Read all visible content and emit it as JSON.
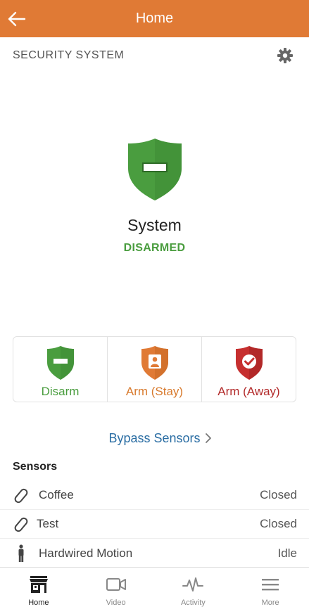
{
  "header": {
    "title": "Home"
  },
  "section": {
    "title": "SECURITY SYSTEM"
  },
  "system": {
    "name": "System",
    "state": "DISARMED"
  },
  "arm_buttons": [
    {
      "label": "Disarm"
    },
    {
      "label": "Arm (Stay)"
    },
    {
      "label": "Arm (Away)"
    }
  ],
  "bypass": {
    "label": "Bypass Sensors"
  },
  "sensors": {
    "title": "Sensors",
    "items": [
      {
        "name": "Coffee",
        "status": "Closed",
        "icon": "contact-sensor-icon"
      },
      {
        "name": "Test",
        "status": "Closed",
        "icon": "contact-sensor-icon"
      },
      {
        "name": "Hardwired Motion",
        "status": "Idle",
        "icon": "motion-person-icon"
      }
    ]
  },
  "tabs": [
    {
      "label": "Home",
      "icon": "home-store-icon",
      "active": true
    },
    {
      "label": "Video",
      "icon": "video-camera-icon",
      "active": false
    },
    {
      "label": "Activity",
      "icon": "activity-pulse-icon",
      "active": false
    },
    {
      "label": "More",
      "icon": "menu-icon",
      "active": false
    }
  ],
  "colors": {
    "header": "#e07a35",
    "disarmed": "#4a9d3f",
    "stay": "#d87a2d",
    "away": "#b22a2a",
    "link": "#2a6da3"
  }
}
